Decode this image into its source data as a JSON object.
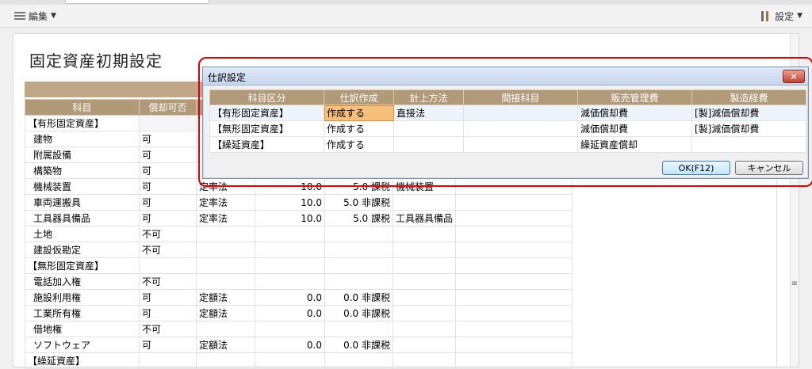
{
  "toolbar": {
    "edit_label": "編集",
    "settings_label": "設定"
  },
  "page": {
    "title": "固定資産初期設定"
  },
  "main_grid": {
    "headers": [
      "科目",
      "償却可否",
      "",
      "",
      "",
      "",
      ""
    ],
    "rows": [
      {
        "label": "【有形固定資産】",
        "category": true,
        "col2": "",
        "col3": "",
        "col4": "",
        "col5": "",
        "col6": ""
      },
      {
        "label": "建物",
        "category": false,
        "col2": "可",
        "col3": "",
        "col4": "",
        "col5": "",
        "col6": ""
      },
      {
        "label": "附属設備",
        "category": false,
        "col2": "可",
        "col3": "",
        "col4": "",
        "col5": "",
        "col6": ""
      },
      {
        "label": "構築物",
        "category": false,
        "col2": "可",
        "col3": "",
        "col4": "",
        "col5": "",
        "col6": ""
      },
      {
        "label": "機械装置",
        "category": false,
        "col2": "可",
        "col3": "定率法",
        "col4": "10.0",
        "col5": "5.0 課税",
        "col6": "機械装置"
      },
      {
        "label": "車両運搬具",
        "category": false,
        "col2": "可",
        "col3": "定率法",
        "col4": "10.0",
        "col5": "5.0 非課税",
        "col6": ""
      },
      {
        "label": "工具器具備品",
        "category": false,
        "col2": "可",
        "col3": "定率法",
        "col4": "10.0",
        "col5": "5.0 課税",
        "col6": "工具器具備品"
      },
      {
        "label": "土地",
        "category": false,
        "col2": "不可",
        "col3": "",
        "col4": "",
        "col5": "",
        "col6": ""
      },
      {
        "label": "建設仮勘定",
        "category": false,
        "col2": "不可",
        "col3": "",
        "col4": "",
        "col5": "",
        "col6": ""
      },
      {
        "label": "【無形固定資産】",
        "category": true,
        "col2": "",
        "col3": "",
        "col4": "",
        "col5": "",
        "col6": ""
      },
      {
        "label": "電話加入権",
        "category": false,
        "col2": "不可",
        "col3": "",
        "col4": "",
        "col5": "",
        "col6": ""
      },
      {
        "label": "施設利用権",
        "category": false,
        "col2": "可",
        "col3": "定額法",
        "col4": "0.0",
        "col5": "0.0 非課税",
        "col6": ""
      },
      {
        "label": "工業所有権",
        "category": false,
        "col2": "可",
        "col3": "定額法",
        "col4": "0.0",
        "col5": "0.0 非課税",
        "col6": ""
      },
      {
        "label": "借地権",
        "category": false,
        "col2": "不可",
        "col3": "",
        "col4": "",
        "col5": "",
        "col6": ""
      },
      {
        "label": "ソフトウェア",
        "category": false,
        "col2": "可",
        "col3": "定額法",
        "col4": "0.0",
        "col5": "0.0 非課税",
        "col6": ""
      },
      {
        "label": "【繰延資産】",
        "category": true,
        "col2": "",
        "col3": "",
        "col4": "",
        "col5": "",
        "col6": ""
      }
    ]
  },
  "scroll_grip": "≡",
  "dialog": {
    "title": "仕訳設定",
    "close_label": "×",
    "headers": [
      "科目区分",
      "仕訳作成",
      "計上方法",
      "間接科目",
      "販売管理費",
      "製造経費"
    ],
    "rows": [
      {
        "kubun": "【有形固定資産】",
        "sakusei": "作成する",
        "houhou": "直接法",
        "kansetsu": "",
        "hanbai": "減価償却費",
        "seizo": "[製]減価償却費"
      },
      {
        "kubun": "【無形固定資産】",
        "sakusei": "作成する",
        "houhou": "",
        "kansetsu": "",
        "hanbai": "減価償却費",
        "seizo": "[製]減価償却費"
      },
      {
        "kubun": "【繰延資産】",
        "sakusei": "作成する",
        "houhou": "",
        "kansetsu": "",
        "hanbai": "繰延資産償却",
        "seizo": ""
      }
    ],
    "ok_label": "OK(F12)",
    "cancel_label": "キャンセル"
  }
}
